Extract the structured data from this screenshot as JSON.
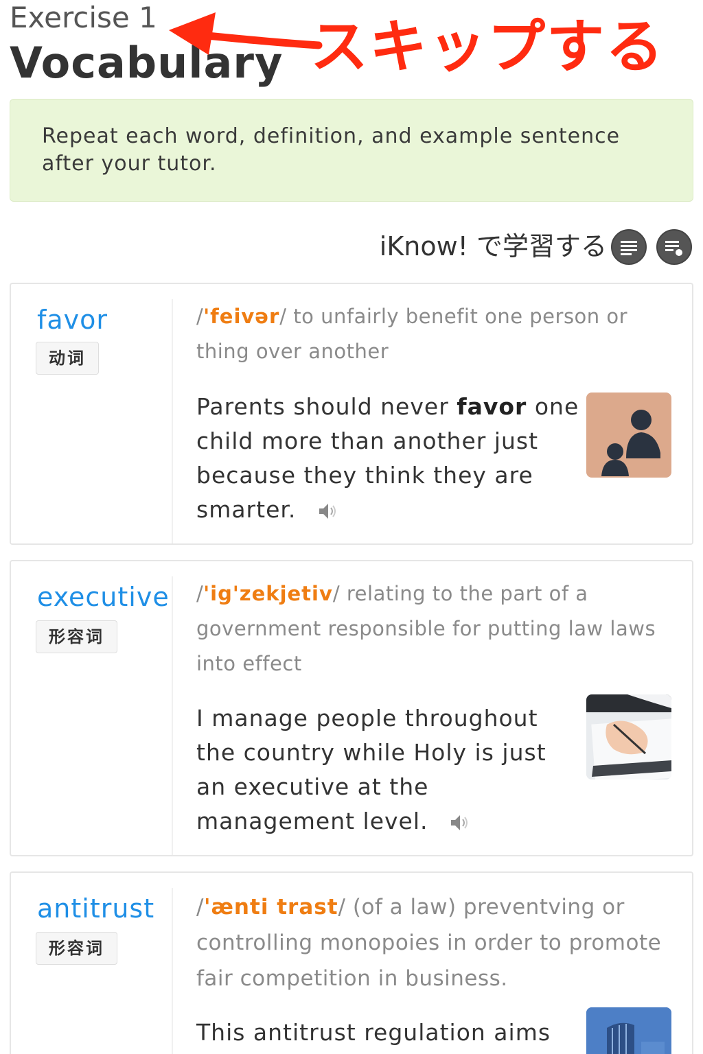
{
  "header": {
    "exercise_label": "Exercise 1",
    "title": "Vocabulary",
    "annotation_text": "スキップする",
    "annotation_color": "#ff2b10"
  },
  "instruction": {
    "text": "Repeat each word, definition, and example sentence after your tutor."
  },
  "toolbar": {
    "iknow_label": "iKnow! で学習する",
    "buttons": [
      {
        "icon": "list-icon"
      },
      {
        "icon": "playlist-icon"
      }
    ]
  },
  "colors": {
    "word": "#1f8fe6",
    "pronunciation": "#ef7d12",
    "definition": "#8a8a8a",
    "instruction_bg": "#eaf6d8"
  },
  "vocab": [
    {
      "word": "favor",
      "pos": "动词",
      "ipa": "'feivər",
      "definition": "to unfairly benefit one person or thing over another",
      "example_before": "Parents should never ",
      "example_bold": "favor",
      "example_after": " one child more than another just because they think they are smarter.",
      "image": "adult-and-child-silhouette-icon"
    },
    {
      "word": "executive",
      "pos": "形容词",
      "ipa": "'ig'zekjetiv",
      "definition": "relating to the part of a government responsible for putting law laws into effect",
      "example_before": "I manage people throughout the country while Holy is just an executive at the management level.",
      "example_bold": "",
      "example_after": "",
      "image": "hand-writing-on-clipboard-photo"
    },
    {
      "word": "antitrust",
      "pos": "形容词",
      "ipa": "'ænti trast",
      "definition": "(of a law) preventving or controlling monopoies in order to promote fair competition in business.",
      "example_before": "This antitrust regulation aims",
      "example_bold": "",
      "example_after": "",
      "image": "office-building-photo"
    }
  ]
}
